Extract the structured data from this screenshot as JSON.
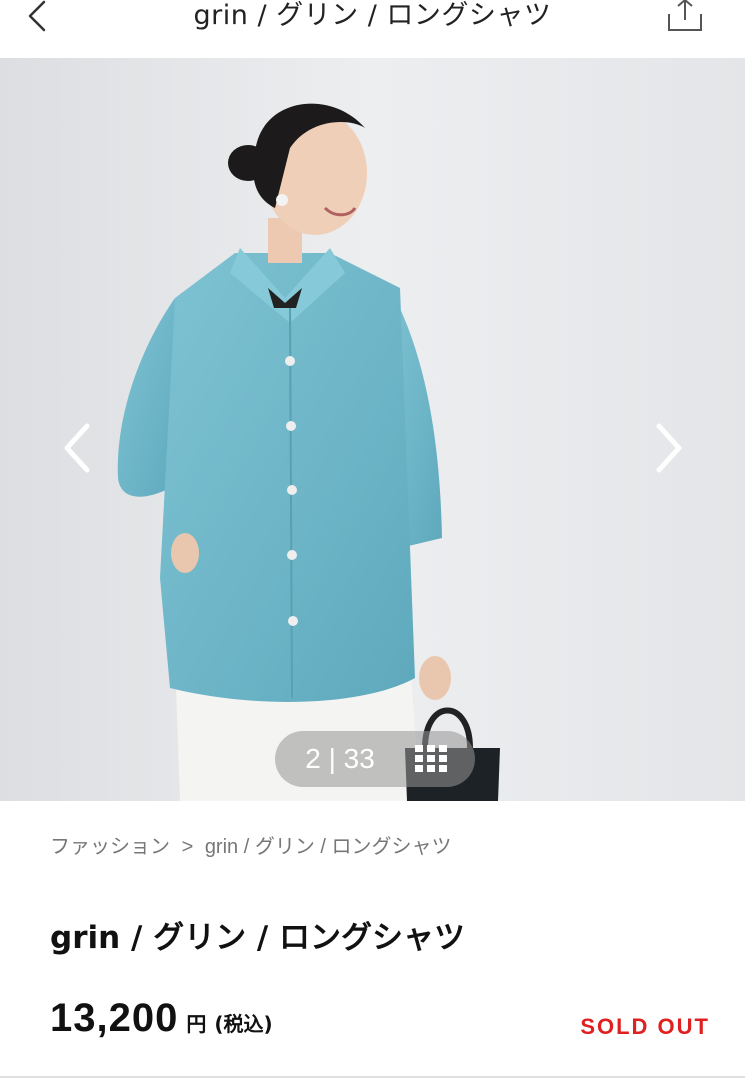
{
  "header": {
    "title": "grin / グリン /  ロングシャツ",
    "back_icon": "chevron-left-icon",
    "share_icon": "share-icon"
  },
  "gallery": {
    "current": "2",
    "separator": "|",
    "total": "33",
    "counter_text": "2 | 33",
    "prev_icon": "chevron-left-icon",
    "next_icon": "chevron-right-icon",
    "grid_icon": "grid-icon"
  },
  "breadcrumb": {
    "items": [
      "ファッション",
      "grin / グリン / ロングシャツ"
    ],
    "separator": ">"
  },
  "product": {
    "title": "grin / グリン / ロングシャツ",
    "price": "13,200",
    "currency": "円",
    "tax_note": "(税込)",
    "status": "SOLD OUT"
  },
  "colors": {
    "status_red": "#e02020",
    "shirt_blue": "#6fb9cc"
  }
}
